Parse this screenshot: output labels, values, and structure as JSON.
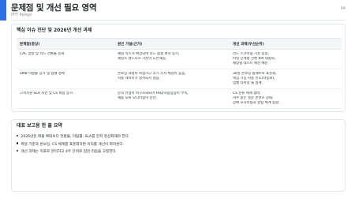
{
  "header": {
    "title": "문제점 및 개선 필요 영역",
    "subtitle": "PPT 4page",
    "page_number": "04",
    "accent_color": "#2f6fe4"
  },
  "issues_card": {
    "title": "핵심 이슈 진단 및 2026년 개선 과제",
    "columns": [
      "문제점(증상)",
      "원인 가설(근거)",
      "개선 과제(우선순위)"
    ],
    "rows": [
      {
        "symptom": [
          "CAC 상승 및 리드 전환율 둔화"
        ],
        "cause": [
          "채널 믹스가 확장되며 리드 품질 편차 증가,",
          "세일즈 핸드오프 기준이 느슨해짐."
        ],
        "task": [
          "리드 스코어링 기준 통일,",
          "퍼널 단계별 전환 KPI 재정의,",
          "채널별 테스트 예산 배분."
        ]
      },
      {
        "symptom": [
          "SMB 이탈률 증가 및 업셀 정체"
        ],
        "cause": [
          "온보딩 과정이 복잡하고 초기 가치 체감이 늦음,",
          "사용 데이터가 정착되지 않음."
        ],
        "task": [
          "30일 온보딩 플레이북 표준화,",
          "핵심 기능 사용 유도(자동화),",
          "업셀 타이밍 룰 설계."
        ]
      },
      {
        "symptom": [
          "고객지원 SLA 지연 및 CS 비용 증가"
        ],
        "cause": [
          "문의 유형이 비구조화되어 FAQ/자동응답이 부족,",
          "제품 오류 모니터링이 분산."
        ],
        "task": [
          "CS 분류 체계 정비,",
          "자주 묻는 질문 콘텐츠 강화,",
          "장애 모니터링과 알림 체계 통합."
        ]
      }
    ]
  },
  "summary_card": {
    "title": "대표 보고용 한 줄 요약",
    "items": [
      "2026년은 매출 확대보다 전환율, 이탈률, SLA를 먼저 정상화해야 한다.",
      "퍼널 기준과 온보딩, CS 체계를 표준화하면 이익률 개선이 따라온다.",
      "개선 과제는 지표로 관리하고 4주 단위로 점검 리듬을 고정한다."
    ]
  }
}
